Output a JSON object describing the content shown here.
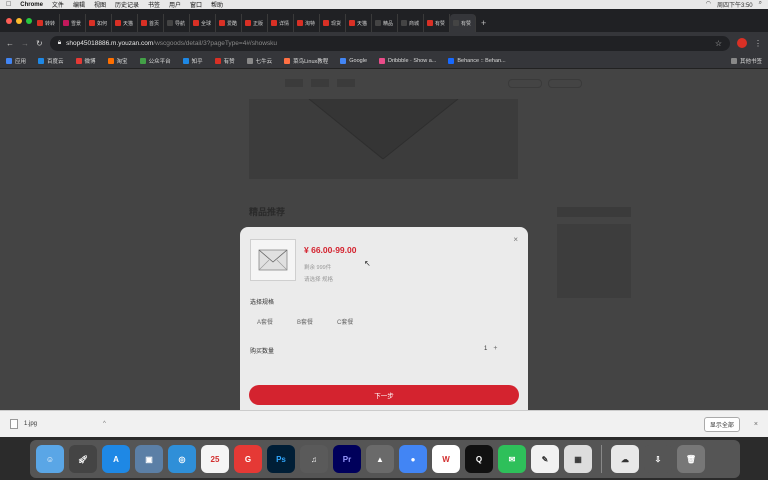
{
  "menubar": {
    "app": "Chrome",
    "items": [
      "文件",
      "编辑",
      "视图",
      "历史记录",
      "书签",
      "用户",
      "窗口",
      "帮助"
    ],
    "clock": "周四下午3:50"
  },
  "tabs": [
    {
      "label": "转转",
      "color": "#d93025"
    },
    {
      "label": "雪景",
      "color": "#c2185b"
    },
    {
      "label": "如何",
      "color": "#d93025"
    },
    {
      "label": "天猫",
      "color": "#d93025"
    },
    {
      "label": "首页",
      "color": "#d93025"
    },
    {
      "label": "导航",
      "color": "#444"
    },
    {
      "label": "全球",
      "color": "#d93025"
    },
    {
      "label": "爱酷",
      "color": "#d93025"
    },
    {
      "label": "正版",
      "color": "#d93025"
    },
    {
      "label": "详情",
      "color": "#d93025"
    },
    {
      "label": "淘特",
      "color": "#d93025"
    },
    {
      "label": "现货",
      "color": "#d93025"
    },
    {
      "label": "天猫",
      "color": "#d93025"
    },
    {
      "label": "精品",
      "color": "#444"
    },
    {
      "label": "商城",
      "color": "#444"
    },
    {
      "label": "有赞",
      "color": "#d93025"
    },
    {
      "label": "有赞",
      "color": "#444"
    }
  ],
  "address": {
    "domain": "shop45018886.m.youzan.com",
    "path": "/wscgoods/detail/3?pageType=4#/showsku"
  },
  "bookmarks": [
    "应用",
    "百度云",
    "微博",
    "淘宝",
    "微信网页版",
    "公众平台",
    "知乎",
    "有赞",
    "花瓣",
    "七牛云",
    "菜鸟Linux教程",
    "Google",
    "数据",
    "Dribbble · Show a...",
    "Behance :: Behan...",
    "其他书签"
  ],
  "sku": {
    "price": "¥ 66.00-99.00",
    "stock": "剩余 999件",
    "selected": "请选择 规格",
    "spec_label": "选择规格",
    "options": [
      "A套餐",
      "B套餐",
      "C套餐"
    ],
    "qty_label": "购买数量",
    "qty": "1",
    "next": "下一步"
  },
  "page": {
    "title": "精品推荐"
  },
  "download": {
    "file": "1.jpg",
    "show_all": "显示全部"
  }
}
